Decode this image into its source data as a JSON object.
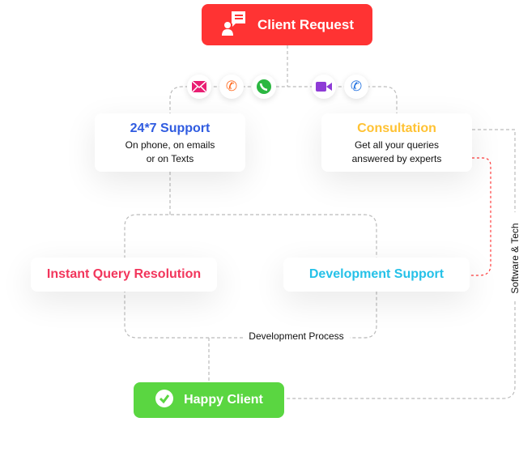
{
  "client_request": {
    "label": "Client Request",
    "icon": "chat-user-icon",
    "color": "#ff3333"
  },
  "channels": [
    {
      "icon": "email-icon",
      "color": "#e91e73"
    },
    {
      "icon": "phone-call-icon",
      "color": "#ff6a1f"
    },
    {
      "icon": "whatsapp-icon",
      "color": "#2bb741"
    },
    {
      "icon": "video-call-icon",
      "color": "#8e3bd6"
    },
    {
      "icon": "phone-icon",
      "color": "#1e6fe0"
    }
  ],
  "support": {
    "title": "24*7 Support",
    "line1": "On phone, on emails",
    "line2": "or on Texts",
    "color": "#2f5be0"
  },
  "consultation": {
    "title": "Consultation",
    "line1": "Get all your queries",
    "line2": "answered by experts",
    "color": "#ffc233"
  },
  "instant": {
    "title": "Instant Query Resolution",
    "color": "#f2355b"
  },
  "dev_support": {
    "title": "Development Support",
    "color": "#25c1e8"
  },
  "dev_process": "Development Process",
  "software_tech": "Software & Tech",
  "happy_client": {
    "label": "Happy Client",
    "icon": "check-circle-icon",
    "color": "#5ad641"
  }
}
